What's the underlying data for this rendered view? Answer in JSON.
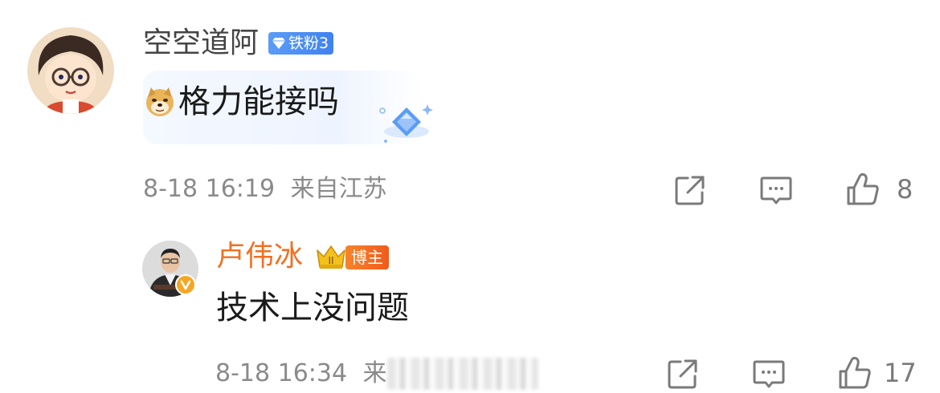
{
  "comment": {
    "user_name": "空空道阿",
    "fan_badge": "铁粉3",
    "text": "格力能接吗",
    "emoji_icon": "doge-icon",
    "timestamp": "8-18 16:19",
    "location": "来自江苏",
    "like_count": "8"
  },
  "reply": {
    "user_name": "卢伟冰",
    "blogger_badge": "博主",
    "text": "技术上没问题",
    "timestamp": "8-18 16:34",
    "location_prefix": "来",
    "like_count": "17"
  },
  "colors": {
    "name_default": "#444444",
    "name_blogger": "#f07022",
    "meta_gray": "#8a8a8a",
    "fan_badge_blue": "#4a8cf4",
    "blogger_badge_orange": "#f26a22"
  }
}
